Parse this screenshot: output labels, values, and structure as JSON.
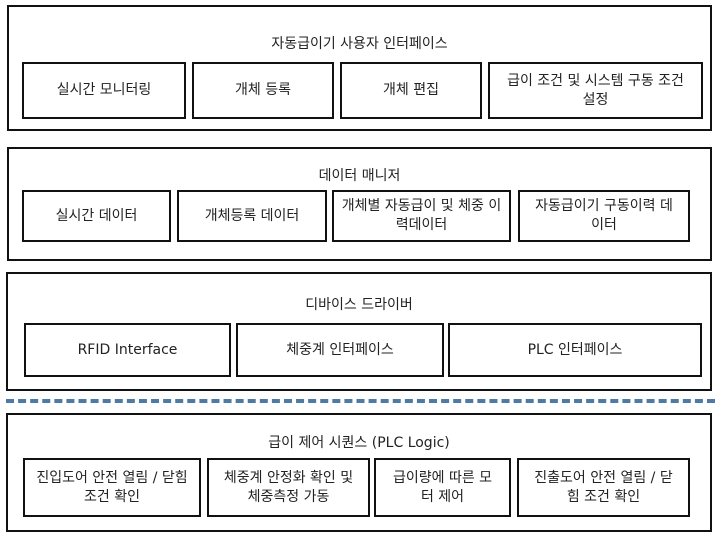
{
  "layers": [
    {
      "title": "자동급이기 사용자 인터페이스",
      "modules": [
        {
          "label": "실시간 모니터링"
        },
        {
          "label": "개체 등록"
        },
        {
          "label": "개체 편집"
        },
        {
          "label": "급이 조건 및 시스템 구동 조건 설정"
        }
      ]
    },
    {
      "title": "데이터 매니저",
      "modules": [
        {
          "label": "실시간 데이터"
        },
        {
          "label": "개체등록 데이터"
        },
        {
          "label": "개체별 자동급이 및 체중 이력데이터"
        },
        {
          "label": "자동급이기 구동이력 데이터"
        }
      ]
    },
    {
      "title": "디바이스 드라이버",
      "modules": [
        {
          "label": "RFID Interface"
        },
        {
          "label": "체중계 인터페이스"
        },
        {
          "label": "PLC 인터페이스"
        }
      ]
    },
    {
      "title": "급이 제어 시퀀스 (PLC Logic)",
      "modules": [
        {
          "label": "진입도어 안전 열림 / 닫힘 조건 확인"
        },
        {
          "label": "체중계 안정화 확인 및 체중측정 가동"
        },
        {
          "label": "급이량에 따른 모터 제어"
        },
        {
          "label": "진출도어 안전 열림 / 닫힘 조건 확인"
        }
      ]
    }
  ],
  "colors": {
    "border": "#111111",
    "divider": "#4f7aa3",
    "spellcheck_underline": "#dd3333"
  }
}
